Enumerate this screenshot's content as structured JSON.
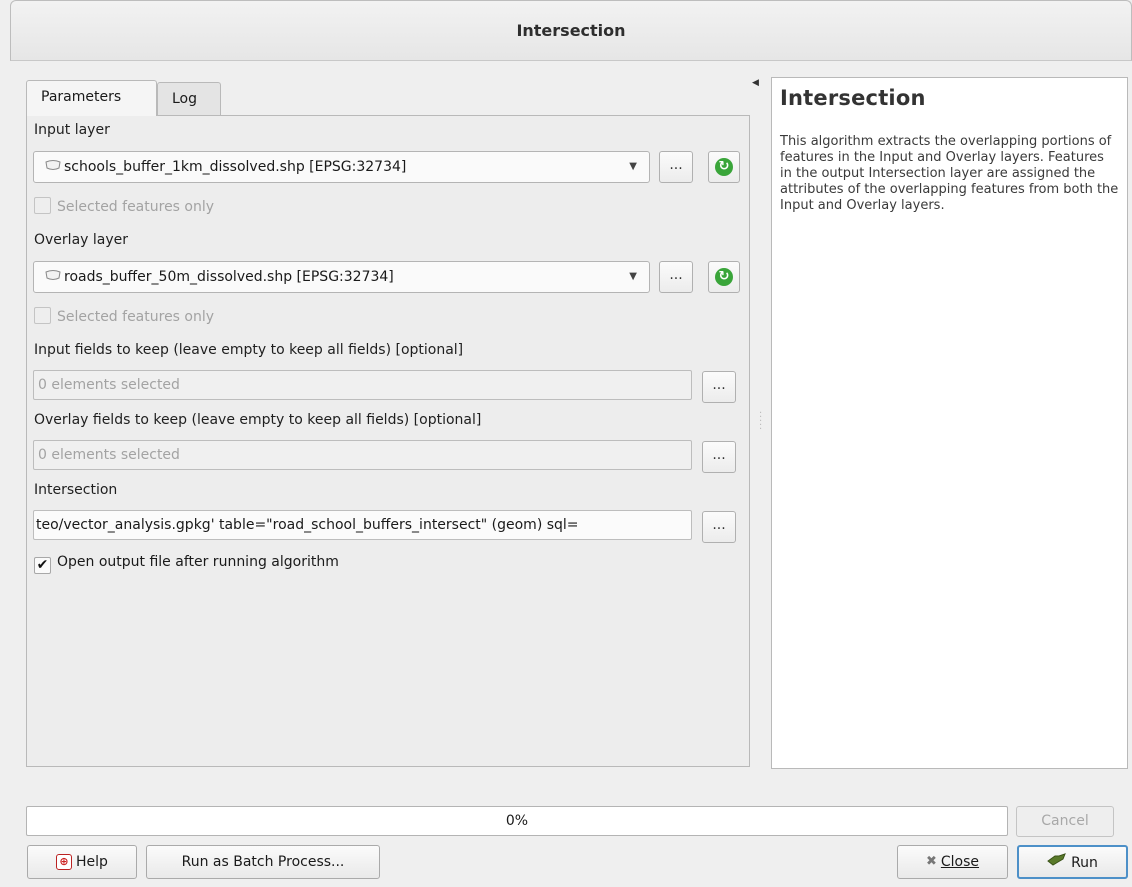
{
  "window": {
    "title": "Intersection"
  },
  "tabs": [
    {
      "label": "Parameters",
      "active": true
    },
    {
      "label": "Log",
      "active": false
    }
  ],
  "params": {
    "input_layer": {
      "label": "Input layer",
      "value": "schools_buffer_1km_dissolved.shp [EPSG:32734]",
      "selected_only": "Selected features only"
    },
    "overlay_layer": {
      "label": "Overlay layer",
      "value": "roads_buffer_50m_dissolved.shp [EPSG:32734]",
      "selected_only": "Selected features only"
    },
    "input_fields": {
      "label": "Input fields to keep (leave empty to keep all fields) [optional]",
      "value": "0 elements selected"
    },
    "overlay_fields": {
      "label": "Overlay fields to keep (leave empty to keep all fields) [optional]",
      "value": "0 elements selected"
    },
    "output": {
      "label": "Intersection",
      "value": "teo/vector_analysis.gpkg' table=\"road_school_buffers_intersect\" (geom) sql="
    },
    "open_output": {
      "label": "Open output file after running algorithm",
      "checked": true
    },
    "dots_label": "...",
    "check_mark": "✔"
  },
  "help": {
    "title": "Intersection",
    "text": "This algorithm extracts the overlapping portions of features in the Input and Overlay layers. Features in the output Intersection layer are assigned the attributes of the overlapping features from both the Input and Overlay layers."
  },
  "progress": {
    "label": "0%",
    "value": 0
  },
  "buttons": {
    "help": "Help",
    "batch": "Run as Batch Process...",
    "cancel": "Cancel",
    "close": "Close",
    "run": "Run"
  },
  "icons": {
    "geometry": "polygon-layer-icon",
    "iterate": "iterate-icon",
    "help": "help-icon",
    "close": "close-x-icon",
    "run": "run-icon"
  }
}
